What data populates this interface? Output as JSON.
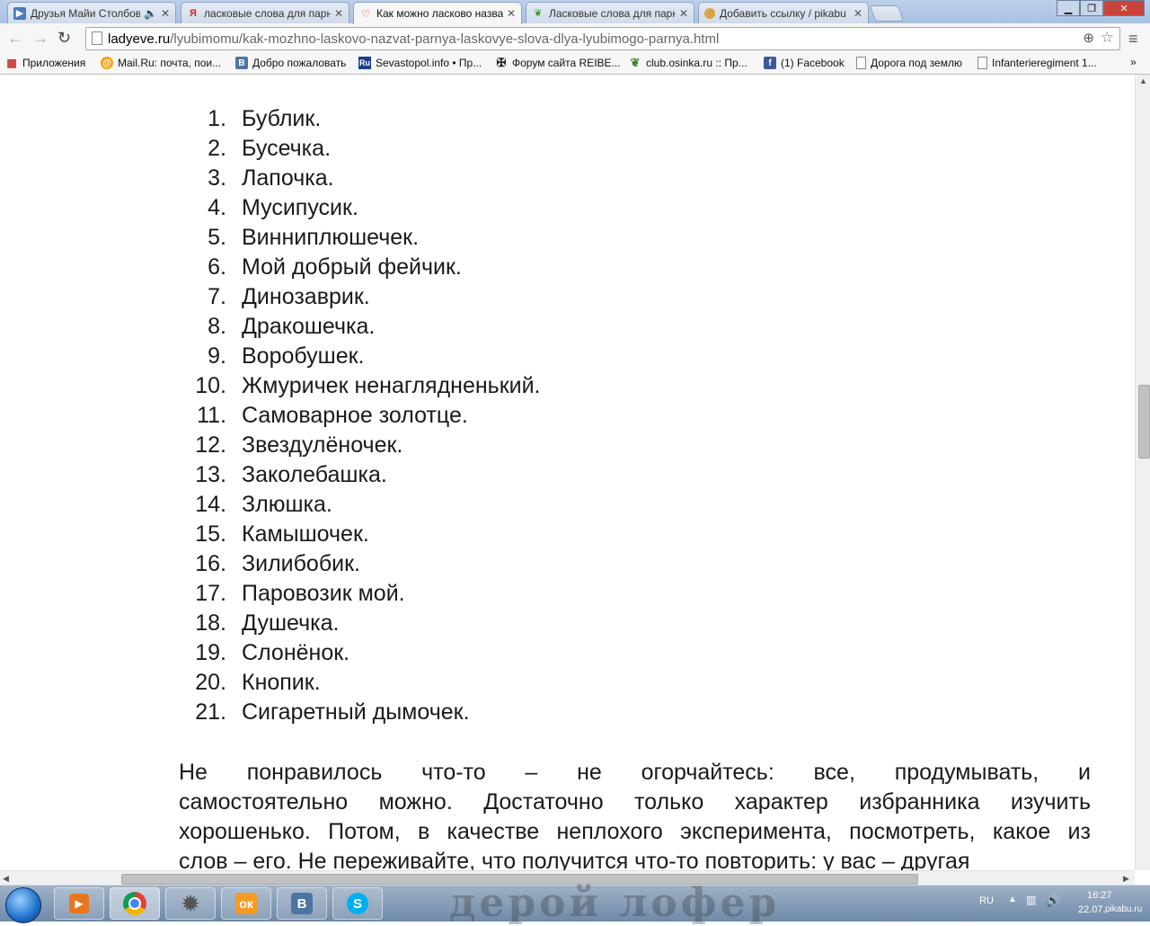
{
  "tabs": [
    {
      "title": "Друзья Майи Столбовой",
      "icon": "video-icon",
      "active": false
    },
    {
      "title": "ласковые слова для парня",
      "icon": "yandex-icon",
      "active": false
    },
    {
      "title": "Как можно ласково назвать",
      "icon": "heart-icon",
      "active": true
    },
    {
      "title": "Ласковые слова для парня",
      "icon": "leaf-icon",
      "active": false
    },
    {
      "title": "Добавить ссылку / pikabu",
      "icon": "pikabu-icon",
      "active": false
    }
  ],
  "address": {
    "host": "ladyeve.ru",
    "path": "/lyubimomu/kak-mozhno-laskovo-nazvat-parnya-laskovye-slova-dlya-lyubimogo-parnya.html"
  },
  "bookmarks": [
    {
      "label": "Приложения",
      "icon": "apps-grid-icon"
    },
    {
      "label": "Mail.Ru: почта, пои...",
      "icon": "mailru-icon"
    },
    {
      "label": "Добро пожаловать",
      "icon": "vk-icon"
    },
    {
      "label": "Sevastopol.info • Пр...",
      "icon": "ru-icon"
    },
    {
      "label": "Форум сайта REIBE...",
      "icon": "cross-icon"
    },
    {
      "label": "club.osinka.ru :: Пр...",
      "icon": "leaf-icon"
    },
    {
      "label": "(1) Facebook",
      "icon": "facebook-icon"
    },
    {
      "label": "Дорога под землю",
      "icon": "page-icon"
    },
    {
      "label": "Infanterieregiment 1...",
      "icon": "page-icon"
    }
  ],
  "list": [
    {
      "num": "1.",
      "text": "Бублик."
    },
    {
      "num": "2.",
      "text": "Бусечка."
    },
    {
      "num": "3.",
      "text": "Лапочка."
    },
    {
      "num": "4.",
      "text": "Мусипусик."
    },
    {
      "num": "5.",
      "text": "Винниплюшечек."
    },
    {
      "num": "6.",
      "text": "Мой добрый фейчик."
    },
    {
      "num": "7.",
      "text": "Динозаврик."
    },
    {
      "num": "8.",
      "text": "Дракошечка."
    },
    {
      "num": "9.",
      "text": "Воробушек."
    },
    {
      "num": "10.",
      "text": "Жмуричек ненаглядненький."
    },
    {
      "num": "11.",
      "text": "Самоварное золотце."
    },
    {
      "num": "12.",
      "text": "Звездулёночек."
    },
    {
      "num": "13.",
      "text": "Заколебашка."
    },
    {
      "num": "14.",
      "text": "Злюшка."
    },
    {
      "num": "15.",
      "text": "Камышочек."
    },
    {
      "num": "16.",
      "text": "Зилибобик."
    },
    {
      "num": "17.",
      "text": "Паровозик мой."
    },
    {
      "num": "18.",
      "text": "Душечка."
    },
    {
      "num": "19.",
      "text": "Слонёнок."
    },
    {
      "num": "20.",
      "text": "Кнопик."
    },
    {
      "num": "21.",
      "text": "Сигаретный дымочек."
    }
  ],
  "paragraph_lines": [
    "Не понравилось что-то – не огорчайтесь: все, продумывать, и",
    "самостоятельно можно. Достаточно только характер избранника изучить",
    "хорошенько. Потом, в качестве неплохого эксперимента, посмотреть, какое из",
    "слов – его. Не переживайте, что получится что-то повторить: у вас – другая"
  ],
  "taskbar": {
    "background_text": "дерой    лофер",
    "lang": "RU",
    "time": "16:27",
    "date": "22.07.",
    "watermark": "pikabu.ru"
  },
  "colors": {
    "tabstrip": "#a9c1e1",
    "text": "#1a1a1a",
    "url_host": "#000000",
    "url_path": "#666666"
  }
}
